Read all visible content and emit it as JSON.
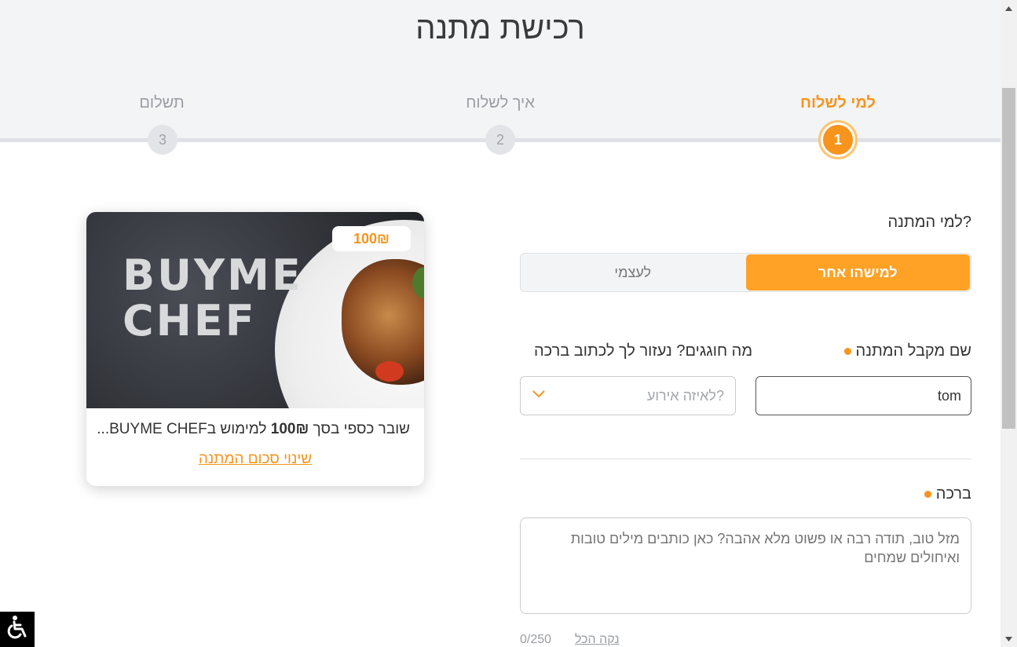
{
  "page": {
    "title": "רכישת מתנה"
  },
  "steps": [
    {
      "label": "למי לשלוח",
      "number": "1",
      "active": true
    },
    {
      "label": "איך לשלוח",
      "number": "2",
      "active": false
    },
    {
      "label": "תשלום",
      "number": "3",
      "active": false
    }
  ],
  "form": {
    "question": "למי המתנה?",
    "toggle": {
      "other": "למישהו אחר",
      "self": "לעצמי",
      "selected": "other"
    },
    "recipient": {
      "label": "שם מקבל המתנה",
      "value": "tom"
    },
    "occasion": {
      "label": "מה חוגגים? נעזור לך לכתוב ברכה",
      "placeholder": "לאיזה אירוע?"
    },
    "greeting": {
      "label": "ברכה",
      "placeholder": "מזל טוב, תודה רבה או פשוט מלא אהבה? כאן כותבים מילים טובות ואיחולים שמחים",
      "counter": "0/250",
      "clear_label": "נקה הכל"
    }
  },
  "card": {
    "logo_line1": "BUYME",
    "logo_line2": "CHEF",
    "price_badge": "100₪",
    "desc_prefix": "שובר כספי בסך ",
    "desc_amount": "100₪",
    "desc_suffix": " למימוש בBUYME CHEF...",
    "change_link": "שינוי סכום המתנה"
  },
  "colors": {
    "accent": "#f7941d",
    "toggle_active": "#ffa226"
  },
  "icons": {
    "accessibility": "wheelchair-icon",
    "dropdown": "chevron-down-icon"
  }
}
